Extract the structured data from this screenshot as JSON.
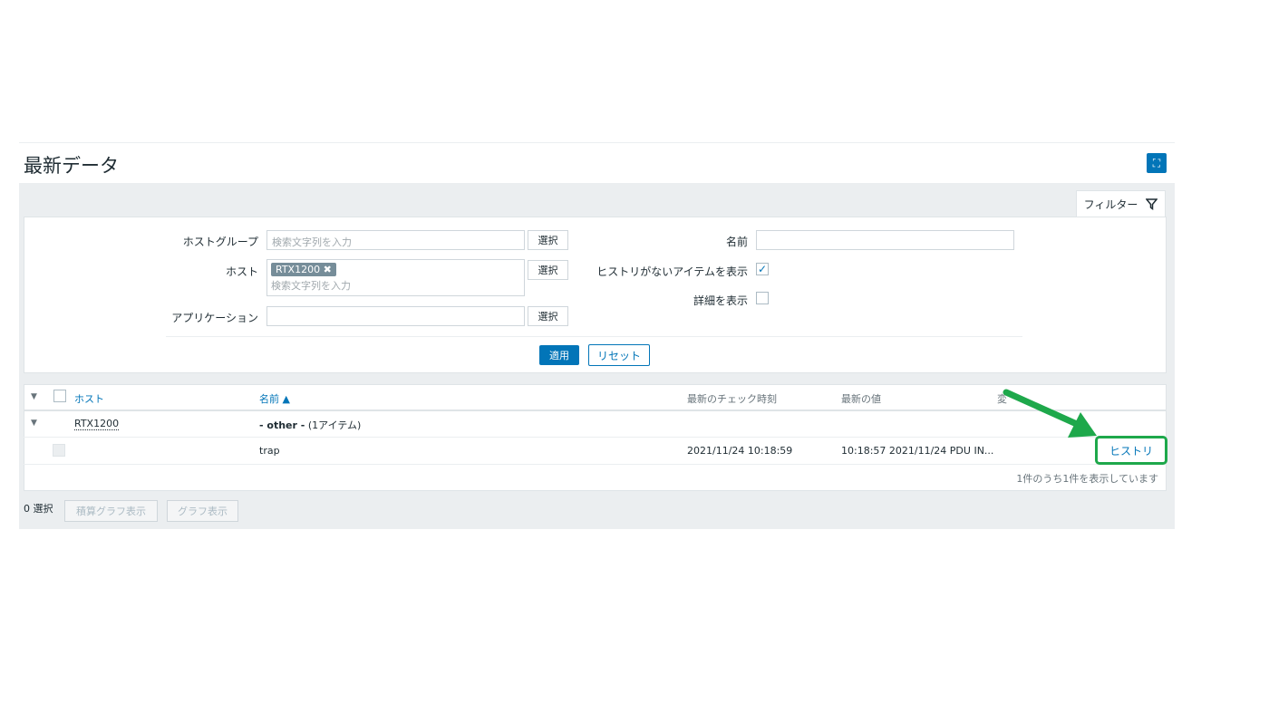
{
  "page": {
    "title": "最新データ"
  },
  "filter": {
    "tab_label": "フィルター",
    "host_group_label": "ホストグループ",
    "host_group_placeholder": "検索文字列を入力",
    "host_label": "ホスト",
    "host_chip": "RTX1200",
    "host_placeholder": "検索文字列を入力",
    "application_label": "アプリケーション",
    "select_label": "選択",
    "name_label": "名前",
    "show_no_history_label": "ヒストリがないアイテムを表示",
    "show_details_label": "詳細を表示",
    "apply_label": "適用",
    "reset_label": "リセット"
  },
  "table": {
    "headers": {
      "host": "ホスト",
      "name": "名前 ▲",
      "last_check": "最新のチェック時刻",
      "last_value": "最新の値",
      "change": "変"
    },
    "group": {
      "host": "RTX1200",
      "label": "- other -",
      "count": "(1アイテム)"
    },
    "row": {
      "name": "trap",
      "last_check": "2021/11/24 10:18:59",
      "last_value": "10:18:57 2021/11/24 PDU IN...",
      "history_link": "ヒストリ"
    },
    "footer": "1件のうち1件を表示しています"
  },
  "bottom": {
    "selected": "0 選択",
    "stacked_graph": "積算グラフ表示",
    "graph": "グラフ表示"
  },
  "colors": {
    "accent": "#0275b8",
    "annotation": "#1ea84b"
  }
}
